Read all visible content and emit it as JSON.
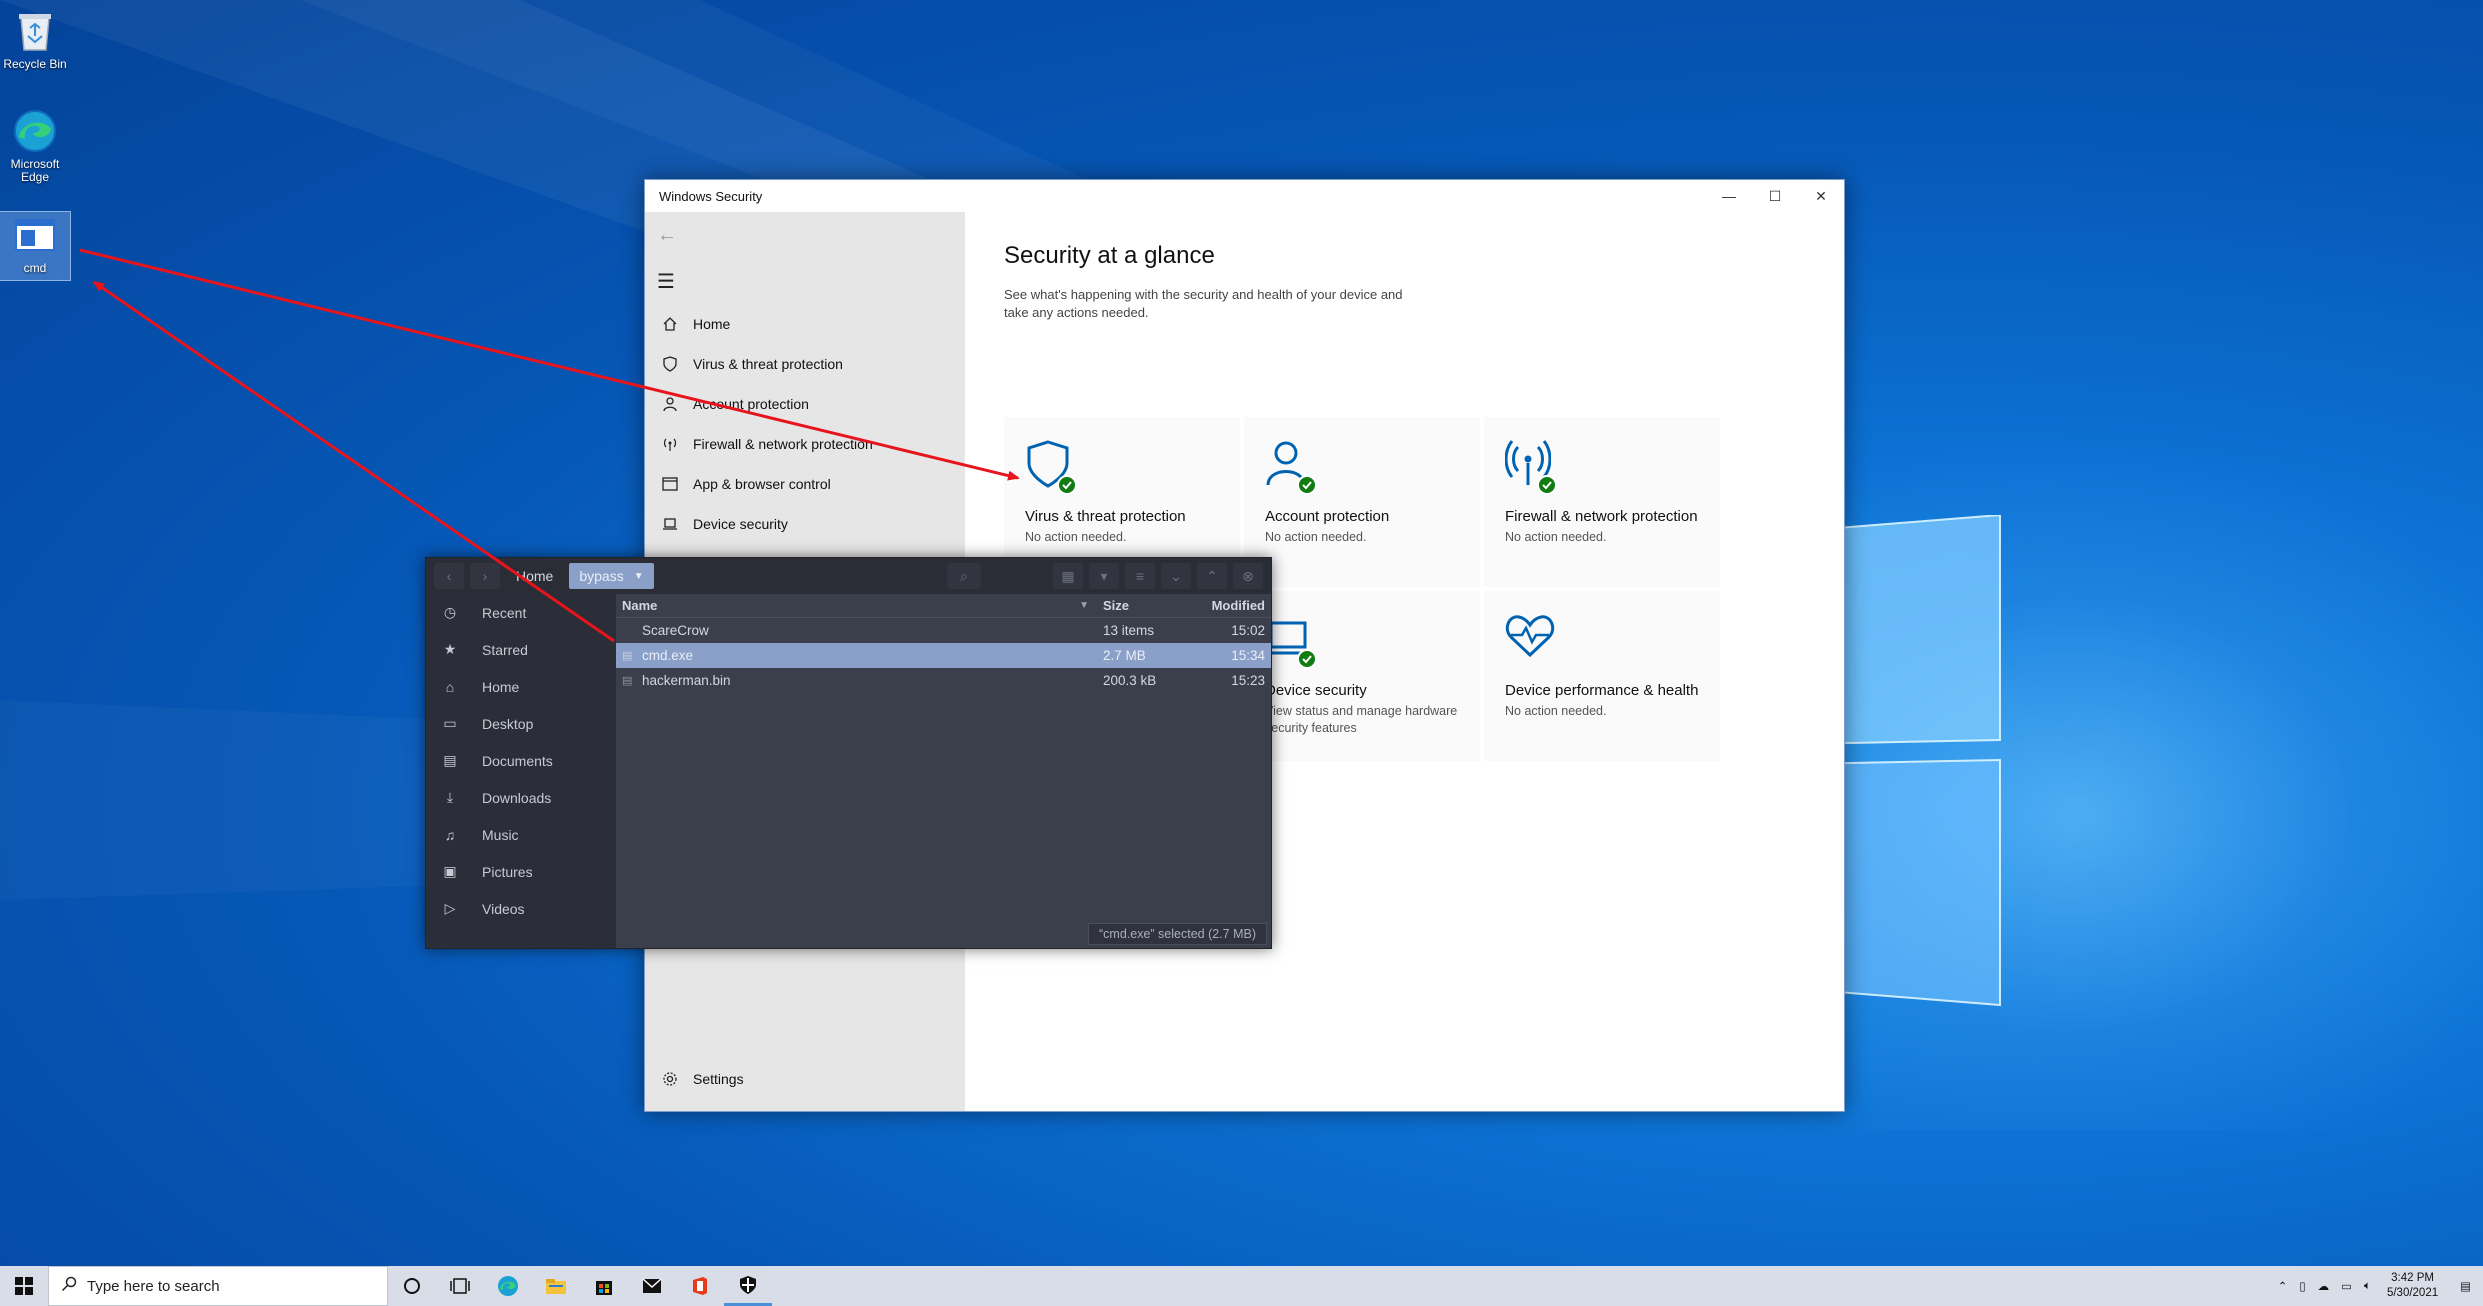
{
  "desktop": {
    "icons": [
      {
        "label": "Recycle Bin"
      },
      {
        "label": "Microsoft Edge"
      },
      {
        "label": "cmd"
      }
    ]
  },
  "security_window": {
    "title": "Windows Security",
    "nav": {
      "home": "Home",
      "virus": "Virus & threat protection",
      "account": "Account protection",
      "firewall": "Firewall & network protection",
      "app_browser": "App & browser control",
      "device_security": "Device security",
      "settings": "Settings"
    },
    "heading": "Security at a glance",
    "subtitle": "See what's happening with the security and health of your device and take any actions needed.",
    "tiles": [
      {
        "title": "Virus & threat protection",
        "status": "No action needed."
      },
      {
        "title": "Account protection",
        "status": "No action needed."
      },
      {
        "title": "Firewall & network protection",
        "status": "No action needed."
      },
      {
        "title": "Device security",
        "status": "View status and manage hardware security features"
      },
      {
        "title": "Device performance & health",
        "status": "No action needed."
      }
    ]
  },
  "file_manager": {
    "breadcrumb": [
      "Home",
      "bypass"
    ],
    "sidebar": [
      "Recent",
      "Starred",
      "Home",
      "Desktop",
      "Documents",
      "Downloads",
      "Music",
      "Pictures",
      "Videos"
    ],
    "columns": {
      "name": "Name",
      "size": "Size",
      "modified": "Modified"
    },
    "rows": [
      {
        "name": "ScareCrow",
        "size": "13 items",
        "modified": "15:02",
        "type": "folder"
      },
      {
        "name": "cmd.exe",
        "size": "2.7 MB",
        "modified": "15:34",
        "type": "file"
      },
      {
        "name": "hackerman.bin",
        "size": "200.3 kB",
        "modified": "15:23",
        "type": "file"
      }
    ],
    "status": "“cmd.exe” selected (2.7 MB)"
  },
  "taskbar": {
    "search_placeholder": "Type here to search",
    "time": "3:42 PM",
    "date": "5/30/2021"
  },
  "colors": {
    "accent": "#0063b1",
    "check_green": "#107c10",
    "annotation_red": "#e8141c",
    "fm_selection": "#8aa0c8"
  }
}
